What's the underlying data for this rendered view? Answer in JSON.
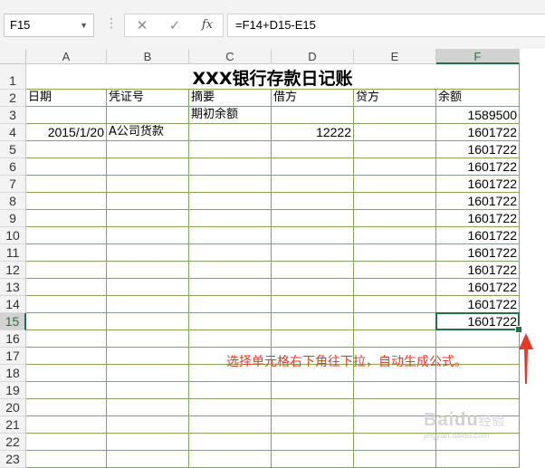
{
  "formula_bar": {
    "name_box": "F15",
    "cancel_icon": "cancel-icon",
    "enter_icon": "check-icon",
    "fx_label": "fx",
    "formula": "=F14+D15-E15"
  },
  "columns": [
    "A",
    "B",
    "C",
    "D",
    "E",
    "F"
  ],
  "selected_column": "F",
  "rows": [
    "1",
    "2",
    "3",
    "4",
    "5",
    "6",
    "7",
    "8",
    "9",
    "10",
    "11",
    "12",
    "13",
    "14",
    "15",
    "16",
    "17",
    "18",
    "19",
    "20",
    "21",
    "22",
    "23"
  ],
  "selected_row": "15",
  "sheet": {
    "title": "XXX银行存款日记账",
    "headers": {
      "A": "日期",
      "B": "凭证号",
      "C": "摘要",
      "D": "借方",
      "E": "贷方",
      "F": "余额"
    },
    "r3": {
      "C": "期初余额",
      "F": "1589500"
    },
    "r4": {
      "A": "2015/1/20",
      "B": "A公司货款",
      "D": "12222",
      "F": "1601722"
    },
    "r5": {
      "F": "1601722"
    },
    "r6": {
      "F": "1601722"
    },
    "r7": {
      "F": "1601722"
    },
    "r8": {
      "F": "1601722"
    },
    "r9": {
      "F": "1601722"
    },
    "r10": {
      "F": "1601722"
    },
    "r11": {
      "F": "1601722"
    },
    "r12": {
      "F": "1601722"
    },
    "r13": {
      "F": "1601722"
    },
    "r14": {
      "F": "1601722"
    },
    "r15": {
      "F": "1601722"
    }
  },
  "annotation": "选择单元格右下角往下拉，自动生成公式。",
  "accent_color": "#217346",
  "annotation_color": "#e33a2c",
  "watermark": {
    "main": "Bai",
    "paw": "du",
    "sub": "经验",
    "url": "jingyan.baidu.com"
  }
}
